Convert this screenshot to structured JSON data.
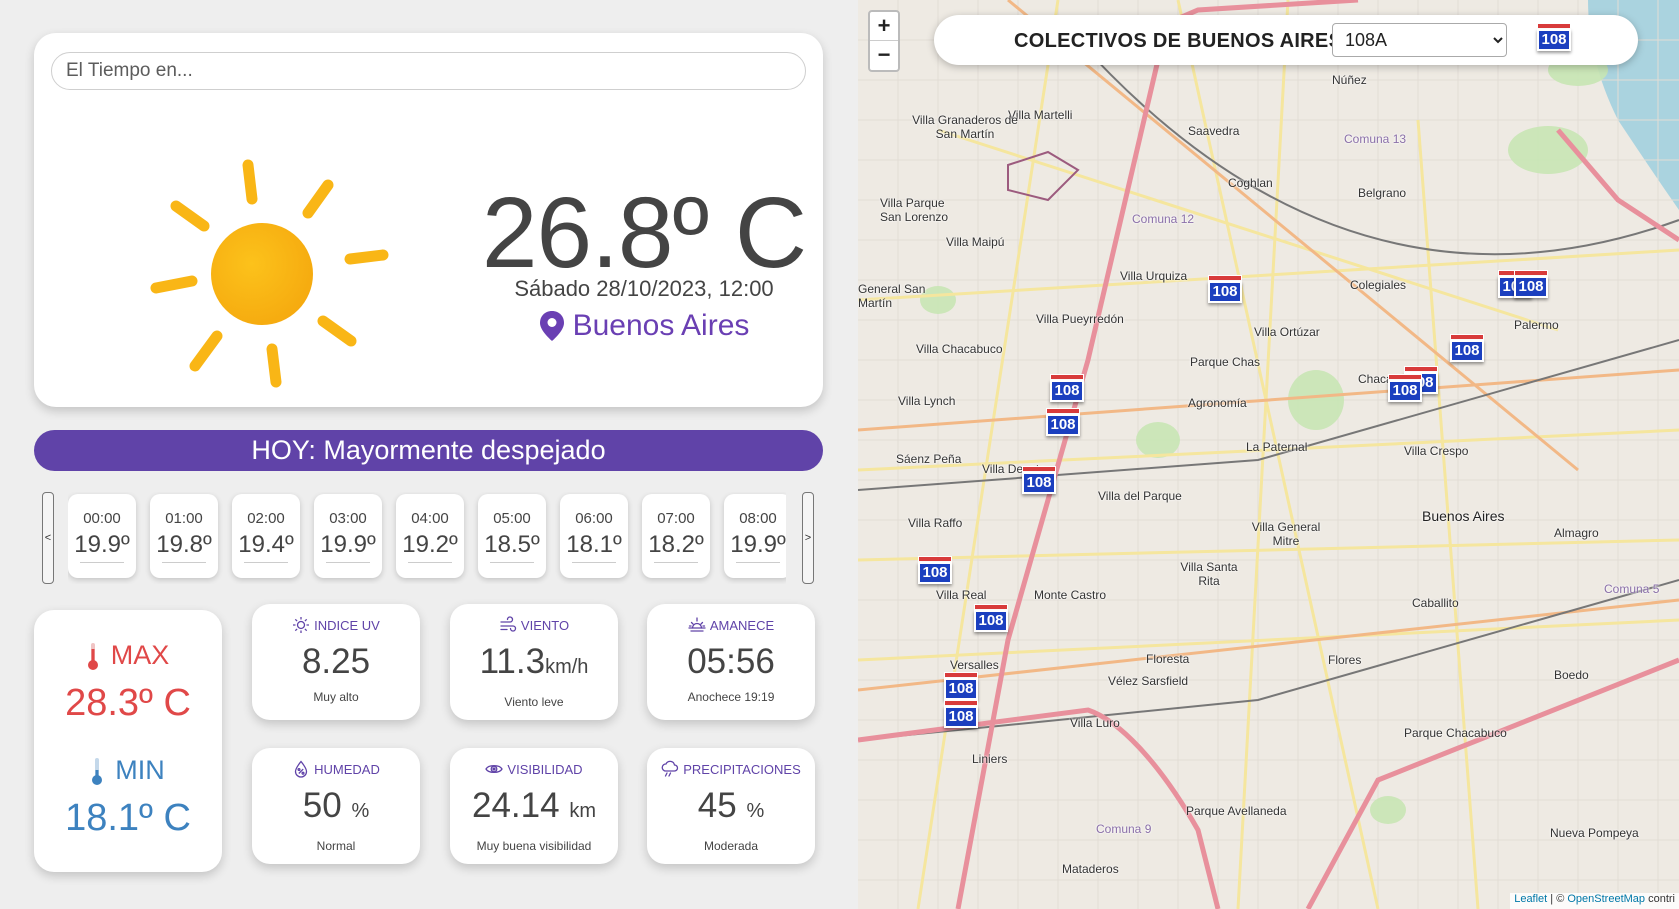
{
  "search": {
    "placeholder": "El Tiempo en..."
  },
  "current": {
    "temperature": "26.8º C",
    "datetime": "Sábado 28/10/2023, 12:00",
    "city": "Buenos Aires",
    "condition_icon": "sun-icon",
    "city_icon": "map-pin-icon"
  },
  "today_banner": "HOY: Mayormente despejado",
  "hourly": {
    "prev_label": "<",
    "next_label": ">",
    "items": [
      {
        "hour": "00:00",
        "temp": "19.9º"
      },
      {
        "hour": "01:00",
        "temp": "19.8º"
      },
      {
        "hour": "02:00",
        "temp": "19.4º"
      },
      {
        "hour": "03:00",
        "temp": "19.9º"
      },
      {
        "hour": "04:00",
        "temp": "19.2º"
      },
      {
        "hour": "05:00",
        "temp": "18.5º"
      },
      {
        "hour": "06:00",
        "temp": "18.1º"
      },
      {
        "hour": "07:00",
        "temp": "18.2º"
      },
      {
        "hour": "08:00",
        "temp": "19.9º"
      }
    ]
  },
  "minmax": {
    "max_label": "MAX",
    "max_value": "28.3º C",
    "min_label": "MIN",
    "min_value": "18.1º C"
  },
  "stats": {
    "uv": {
      "label": "INDICE UV",
      "value": "8.25",
      "unit": "",
      "sub": "Muy alto",
      "icon": "sun-outline-icon"
    },
    "wind": {
      "label": "VIENTO",
      "value": "11.3",
      "unit": "km/h",
      "sub": "Viento leve",
      "icon": "wind-icon"
    },
    "sunrise": {
      "label": "AMANECE",
      "value": "05:56",
      "unit": "",
      "sub": "Anochece 19:19",
      "icon": "sunrise-icon"
    },
    "humidity": {
      "label": "HUMEDAD",
      "value": "50",
      "unit": "%",
      "sub": "Normal",
      "icon": "humidity-icon"
    },
    "visibility": {
      "label": "VISIBILIDAD",
      "value": "24.14",
      "unit": "km",
      "sub": "Muy buena visibilidad",
      "icon": "eye-icon"
    },
    "precip": {
      "label": "PRECIPITACIONES",
      "value": "45",
      "unit": "%",
      "sub": "Moderada",
      "icon": "rain-cloud-icon"
    }
  },
  "map": {
    "zoom_in": "+",
    "zoom_out": "−",
    "title": "COLECTIVOS DE BUENOS AIRES",
    "route_selected": "108A",
    "route_badge": "108",
    "bus_label": "108",
    "attribution_leaflet": "Leaflet",
    "attribution_sep": " | © ",
    "attribution_osm": "OpenStreetMap",
    "attribution_rest": " contri",
    "places": [
      "Villa Martelli",
      "Villa Granaderos de San Martín",
      "Saavedra",
      "Núñez",
      "Coghlan",
      "Belgrano",
      "Villa Parque San Lorenzo",
      "Villa Maipú",
      "General San Martín",
      "Villa Urquiza",
      "Colegiales",
      "Villa Pueyrredón",
      "Villa Ortúzar",
      "Palermo",
      "Villa Chacabuco",
      "Parque Chas",
      "Chacarita",
      "Villa Lynch",
      "Agronomía",
      "La Paternal",
      "Villa Crespo",
      "Sáenz Peña",
      "Villa Devoto",
      "Villa del Parque",
      "Buenos Aires",
      "Almagro",
      "Villa Raffo",
      "Villa General Mitre",
      "Villa Santa Rita",
      "Villa Real",
      "Monte Castro",
      "Caballito",
      "Versalles",
      "Floresta",
      "Flores",
      "Vélez Sarsfield",
      "Boedo",
      "Villa Luro",
      "Liniers",
      "Parque Chacabuco",
      "Parque Avellaneda",
      "Mataderos",
      "Nueva Pompeya",
      "Comuna 12",
      "Comuna 13",
      "Comuna 5",
      "Comuna 9"
    ]
  },
  "colors": {
    "accent": "#6043a8",
    "max": "#e04848",
    "min": "#3d82bf",
    "sun": "#f9b616",
    "bus_body": "#1b3fbf",
    "bus_top": "#d83b3b"
  }
}
